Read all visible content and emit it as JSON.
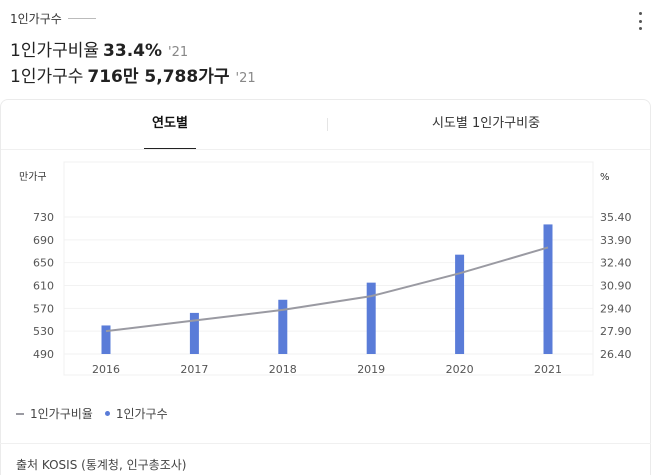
{
  "header": {
    "section_title": "1인가구수",
    "ratio_label": "1인가구비율",
    "ratio_value": "33.4%",
    "ratio_year": "'21",
    "count_label": "1인가구수",
    "count_value": "716만 5,788가구",
    "count_year": "'21"
  },
  "tabs": [
    {
      "label": "연도별",
      "active": true
    },
    {
      "label": "시도별 1인가구비중",
      "active": false
    }
  ],
  "colors": {
    "bar": "#5a7cd8",
    "line": "#9a9aa2"
  },
  "chart_data": {
    "type": "bar+line",
    "categories": [
      "2016",
      "2017",
      "2018",
      "2019",
      "2020",
      "2021"
    ],
    "y_left_unit": "만가구",
    "y_right_unit": "%",
    "y_left_ticks": [
      "730",
      "690",
      "650",
      "610",
      "570",
      "530",
      "490"
    ],
    "y_right_ticks": [
      "35.40",
      "33.90",
      "32.40",
      "30.90",
      "29.40",
      "27.90",
      "26.40"
    ],
    "ylim_left": [
      490,
      730
    ],
    "ylim_right": [
      26.4,
      35.4
    ],
    "series": [
      {
        "name": "1인가구수",
        "type": "bar",
        "axis": "left",
        "values": [
          540,
          562,
          585,
          615,
          664,
          717
        ]
      },
      {
        "name": "1인가구비율",
        "type": "line",
        "axis": "right",
        "values": [
          27.9,
          28.6,
          29.3,
          30.2,
          31.7,
          33.4
        ]
      }
    ],
    "grid": true
  },
  "source": "출처 KOSIS (통계청, 인구총조사)"
}
